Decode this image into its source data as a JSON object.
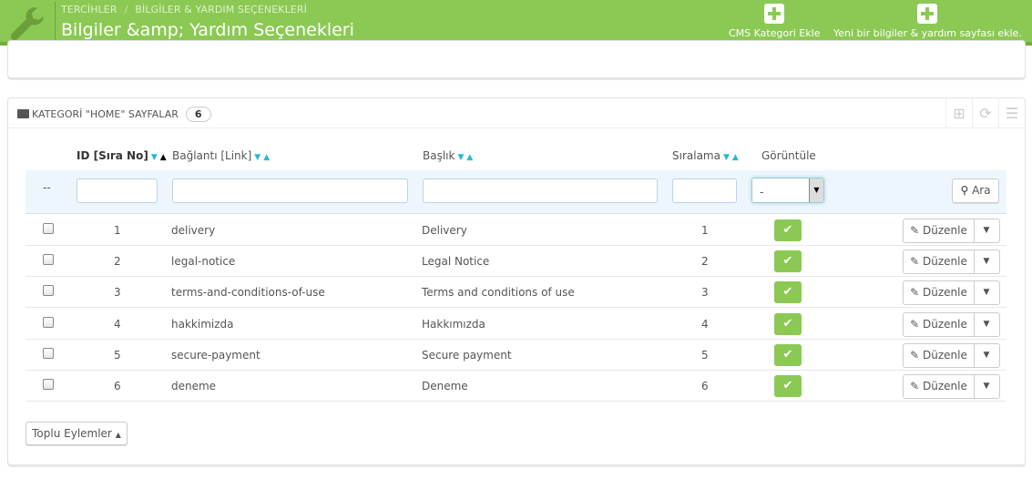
{
  "header": {
    "breadcrumb": [
      "TERCİHLER",
      "BİLGİLER & YARDIM SEÇENEKLERİ"
    ],
    "breadcrumb_sep": "/",
    "title": "Bilgiler &amp; Yardım Seçenekleri",
    "toolbar": [
      {
        "label": "CMS Kategori Ekle",
        "icon": "plus-icon"
      },
      {
        "label": "Yeni bir bilgiler & yardım sayfası ekle.",
        "icon": "plus-icon"
      }
    ]
  },
  "panel": {
    "title": "KATEGORİ \"HOME\" SAYFALAR",
    "count": "6"
  },
  "columns": {
    "id": "ID [Sıra No]",
    "link": "Bağlantı [Link]",
    "title": "Başlık",
    "order": "Sıralama",
    "display": "Görüntüle"
  },
  "filter": {
    "dash": "--",
    "display_value": "-",
    "search": "Ara"
  },
  "rows": [
    {
      "id": "1",
      "link": "delivery",
      "title": "Delivery",
      "order": "1"
    },
    {
      "id": "2",
      "link": "legal-notice",
      "title": "Legal Notice",
      "order": "2"
    },
    {
      "id": "3",
      "link": "terms-and-conditions-of-use",
      "title": "Terms and conditions of use",
      "order": "3"
    },
    {
      "id": "4",
      "link": "hakkimizda",
      "title": "Hakkımızda",
      "order": "4"
    },
    {
      "id": "5",
      "link": "secure-payment",
      "title": "Secure payment",
      "order": "5"
    },
    {
      "id": "6",
      "link": "deneme",
      "title": "Deneme",
      "order": "6"
    }
  ],
  "edit_label": "Düzenle",
  "bulk_label": "Toplu Eylemler",
  "colors": {
    "accent": "#8bc954",
    "info": "#25b9d7"
  }
}
